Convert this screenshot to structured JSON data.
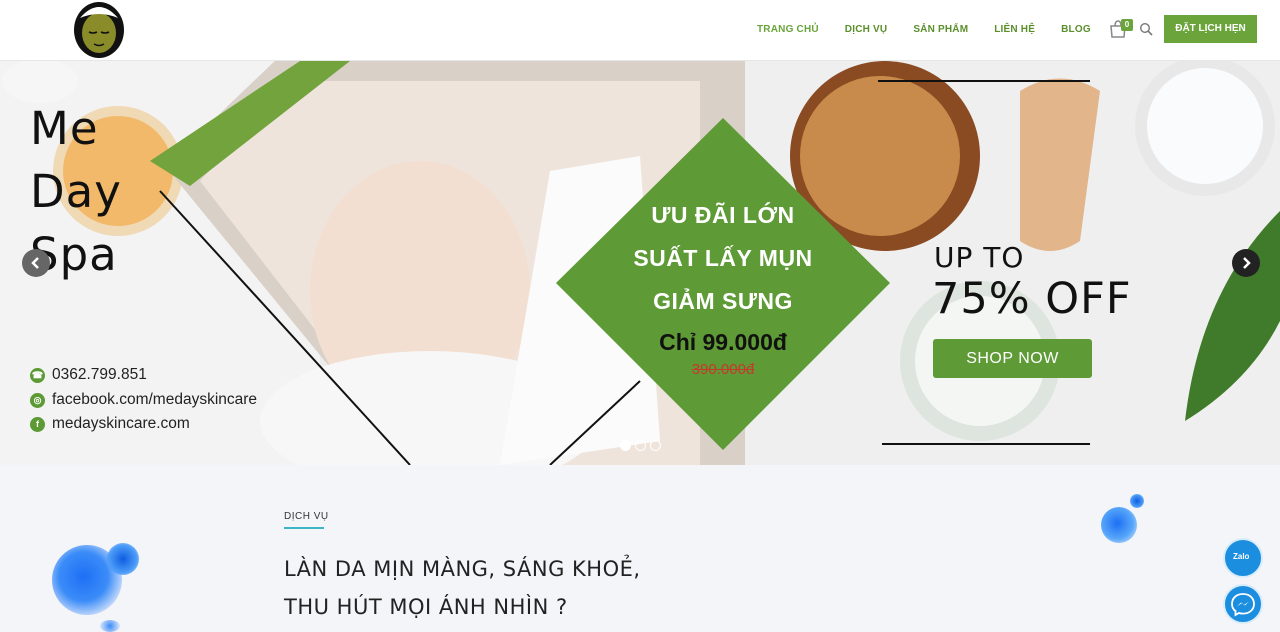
{
  "header": {
    "nav": [
      {
        "label": "TRANG CHỦ"
      },
      {
        "label": "DỊCH VỤ"
      },
      {
        "label": "SẢN PHẨM"
      },
      {
        "label": "LIÊN HỆ"
      },
      {
        "label": "BLOG"
      }
    ],
    "cart_count": "0",
    "book_button": "ĐẶT LỊCH HẸN",
    "accent_color": "#6aa43a"
  },
  "hero": {
    "brand_line1": "Me",
    "brand_line2": "Day",
    "brand_line3": "Spa",
    "contacts": [
      {
        "icon": "phone-icon",
        "text": "0362.799.851"
      },
      {
        "icon": "globe-icon",
        "text": "facebook.com/medayskincare"
      },
      {
        "icon": "facebook-icon",
        "text": "medayskincare.com"
      }
    ],
    "promo_line1": "ƯU ĐÃI LỚN",
    "promo_line2": "SUẤT LẤY MỤN",
    "promo_line3": "GIẢM SƯNG",
    "promo_price": "Chỉ 99.000đ",
    "promo_old_price": "390.000đ",
    "upto": "UP TO",
    "off": "75% OFF",
    "shop_button": "SHOP NOW",
    "slides_total": 3,
    "slide_active": 1
  },
  "section": {
    "label": "DỊCH VỤ",
    "title_line1": "LÀN DA MỊN MÀNG, SÁNG KHOẺ,",
    "title_line2": "THU HÚT MỌI ÁNH NHÌN ?"
  },
  "floating": {
    "zalo_label": "Zalo"
  }
}
